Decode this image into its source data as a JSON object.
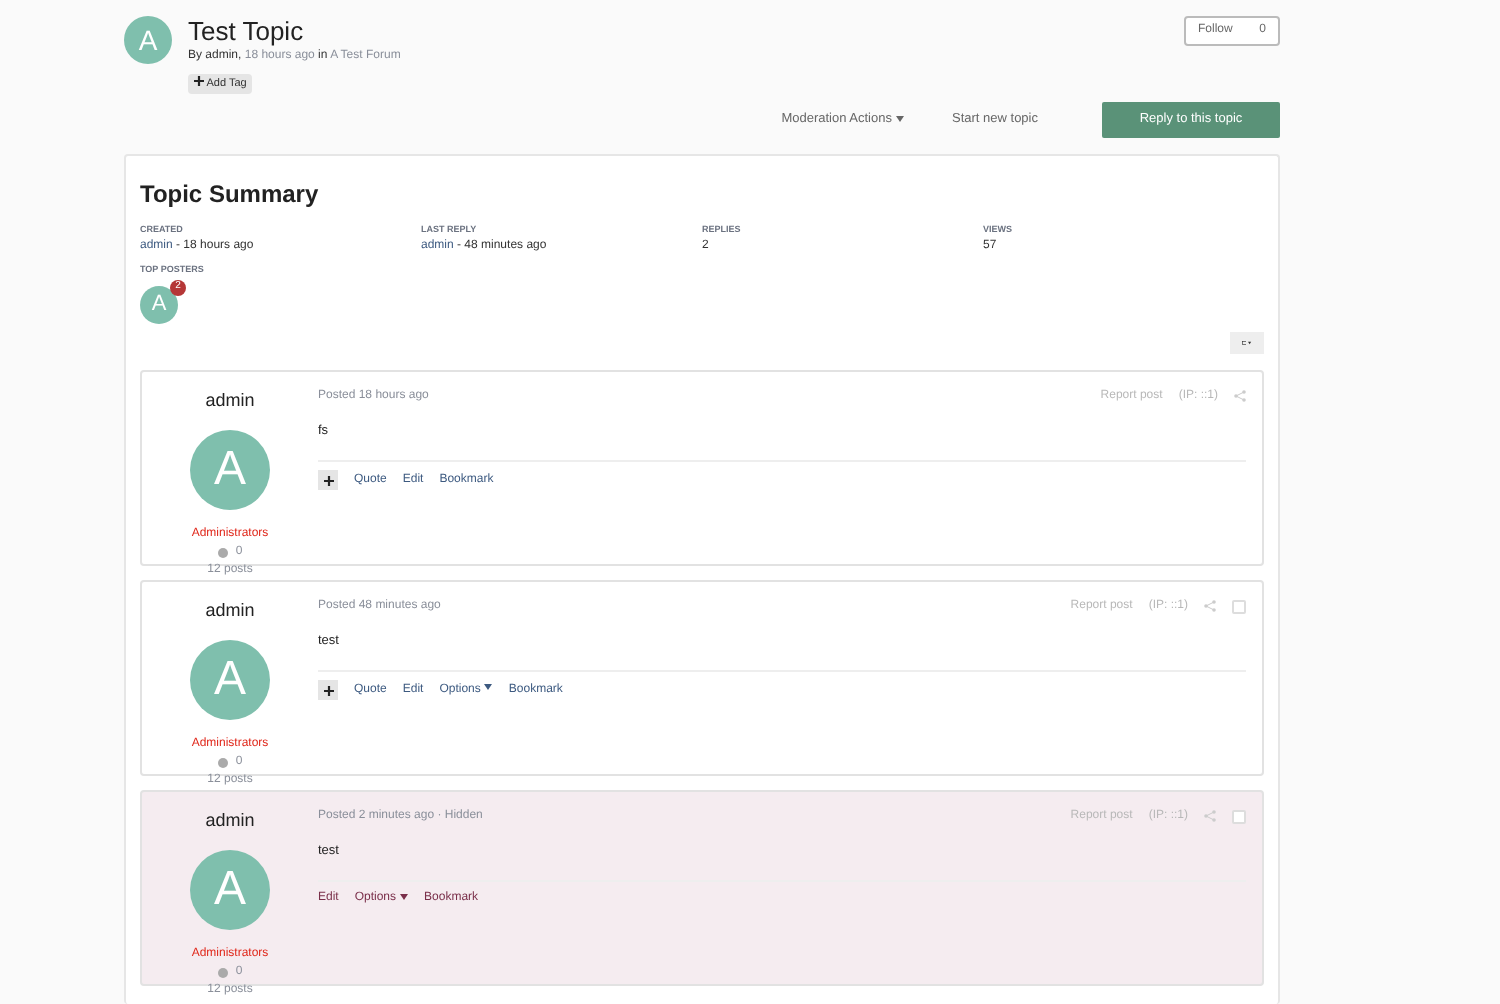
{
  "topic": {
    "avatar_letter": "A",
    "title": "Test Topic",
    "byline_prefix": "By admin, ",
    "byline_time": "18 hours ago",
    "byline_in": " in ",
    "forum": "A Test Forum",
    "add_tag": "Add Tag"
  },
  "follow": {
    "label": "Follow",
    "count": "0"
  },
  "actions": {
    "moderation": "Moderation Actions",
    "start": "Start new topic",
    "reply": "Reply to this topic"
  },
  "summary": {
    "title": "Topic Summary",
    "stats": [
      {
        "label": "CREATED",
        "user": "admin",
        "value": " - 18 hours ago"
      },
      {
        "label": "LAST REPLY",
        "user": "admin",
        "value": " - 48 minutes ago"
      },
      {
        "label": "REPLIES",
        "value": "2"
      },
      {
        "label": "VIEWS",
        "value": "57"
      }
    ],
    "top_posters_label": "TOP POSTERS",
    "top_posters": [
      {
        "letter": "A",
        "count": "2"
      }
    ]
  },
  "posts": [
    {
      "author": "admin",
      "letter": "A",
      "group": "Administrators",
      "reputation": "0",
      "post_count": "12 posts",
      "posted": "Posted 18 hours ago",
      "hidden": false,
      "body": "fs",
      "report": "Report post",
      "ip": "(IP: ::1)",
      "actions": [
        {
          "kind": "plus"
        },
        {
          "label": "Quote",
          "kind": "link"
        },
        {
          "label": "Edit",
          "kind": "link"
        },
        {
          "label": "Bookmark",
          "kind": "link"
        }
      ]
    },
    {
      "author": "admin",
      "letter": "A",
      "group": "Administrators",
      "reputation": "0",
      "post_count": "12 posts",
      "posted": "Posted 48 minutes ago",
      "hidden": false,
      "body": "test",
      "report": "Report post",
      "ip": "(IP: ::1)",
      "select_checkbox": {
        "checked": false
      },
      "actions": [
        {
          "kind": "plus"
        },
        {
          "label": "Quote",
          "kind": "link"
        },
        {
          "label": "Edit",
          "kind": "link"
        },
        {
          "label": "Options",
          "kind": "menu"
        },
        {
          "label": "Bookmark",
          "kind": "link"
        }
      ]
    },
    {
      "author": "admin",
      "letter": "A",
      "group": "Administrators",
      "reputation": "0",
      "post_count": "12 posts",
      "posted": "Posted 2 minutes ago",
      "hidden_label": " · Hidden",
      "hidden": true,
      "body": "test",
      "report": "Report post",
      "ip": "(IP: ::1)",
      "select_checkbox": {
        "checked": false
      },
      "actions": [
        {
          "label": "Edit",
          "kind": "link"
        },
        {
          "label": "Options",
          "kind": "menu"
        },
        {
          "label": "Bookmark",
          "kind": "link"
        }
      ]
    }
  ]
}
